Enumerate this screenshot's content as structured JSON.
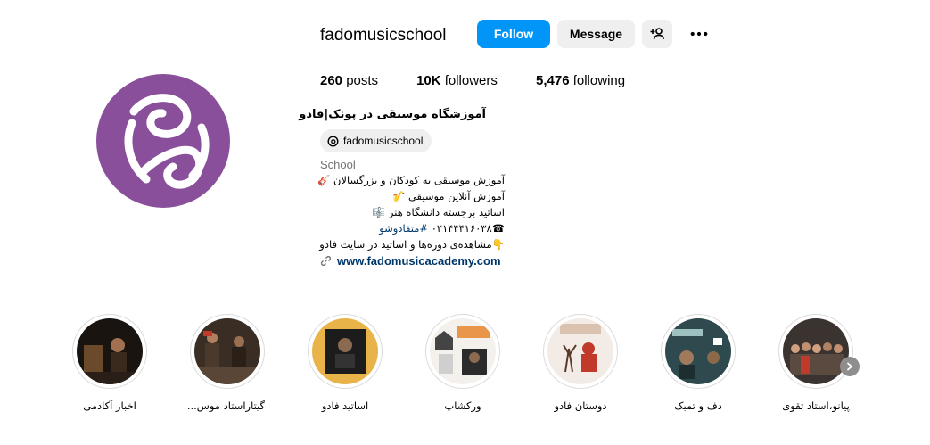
{
  "profile": {
    "username": "fadomusicschool",
    "avatar_icon": "fado-logo-icon",
    "avatar_color": "#8a4f9b",
    "buttons": {
      "follow": "Follow",
      "message": "Message",
      "add_user_icon": "add-user-icon",
      "more_icon": "more-options-icon"
    },
    "stats": {
      "posts_count": "260",
      "posts_label": " posts",
      "followers_count": "10K",
      "followers_label": " followers",
      "following_count": "5,476",
      "following_label": " following"
    },
    "full_name": "آموزشگاه موسیقی در پونک|فادو",
    "threads_handle": "fadomusicschool",
    "category": "School",
    "bio_lines": [
      "آموزش موسیقی به کودکان و بزرگسالان 🎸",
      "آموزش آنلاین موسیقی 🎷",
      "اساتید برجسته دانشگاه هنر 🎼",
      "☎۰۲۱۴۴۴۱۶۰۳۸",
      "#متفادوشو",
      "👇مشاهده‌ی دوره‌ها و اساتید در سایت فادو"
    ],
    "website": "www.fadomusicacademy.com"
  },
  "highlights": [
    {
      "label": "اخبار آکادمی"
    },
    {
      "label": "گیتاراستاد موس..."
    },
    {
      "label": "اساتید فادو"
    },
    {
      "label": "ورکشاپ"
    },
    {
      "label": "دوستان فادو"
    },
    {
      "label": "دف و تمبک"
    },
    {
      "label": "پیانو،استاد تقوی"
    }
  ],
  "colors": {
    "accent": "#0095f6",
    "button_gray": "#efefef",
    "link": "#00376b",
    "muted": "#737373"
  }
}
